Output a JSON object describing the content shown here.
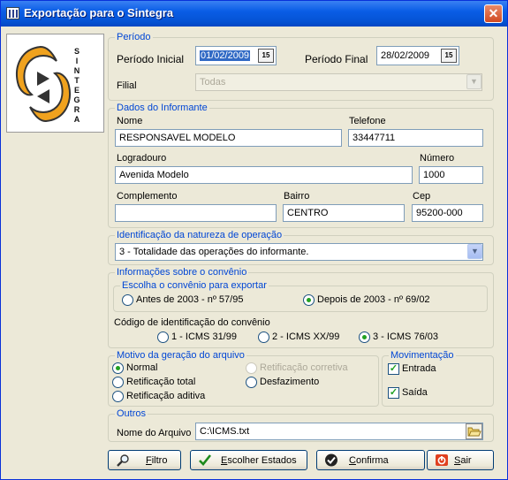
{
  "window": {
    "title": "Exportação para o Sintegra",
    "close_glyph": "✕"
  },
  "logo": {
    "letters": [
      "S",
      "I",
      "N",
      "T",
      "E",
      "G",
      "R",
      "A"
    ]
  },
  "periodo": {
    "legend": "Período",
    "inicial_label": "Período Inicial",
    "inicial_value": "01/02/2009",
    "final_label": "Período Final",
    "final_value": "28/02/2009",
    "calendar_icon": "calendar-icon",
    "calendar_glyph": "15",
    "filial_label": "Filial",
    "filial_value": "Todas"
  },
  "informante": {
    "legend": "Dados do Informante",
    "nome_label": "Nome",
    "nome_value": "RESPONSAVEL MODELO",
    "telefone_label": "Telefone",
    "telefone_value": "33447711",
    "logradouro_label": "Logradouro",
    "logradouro_value": "Avenida Modelo",
    "numero_label": "Número",
    "numero_value": "1000",
    "complemento_label": "Complemento",
    "complemento_value": "",
    "bairro_label": "Bairro",
    "bairro_value": "CENTRO",
    "cep_label": "Cep",
    "cep_value": "95200-000"
  },
  "natureza": {
    "legend": "Identificação da natureza de operação",
    "value": "3 - Totalidade das operações do informante."
  },
  "convenio": {
    "legend": "Informações sobre o convênio",
    "escolha_legend": "Escolha o convênio para exportar",
    "opt_antes": "Antes de 2003 - nº 57/95",
    "opt_depois": "Depois de 2003 - nº 69/02",
    "codigo_label": "Código de identificação do convênio",
    "cod_1": "1 - ICMS 31/99",
    "cod_2": "2 - ICMS XX/99",
    "cod_3": "3 - ICMS 76/03"
  },
  "motivo": {
    "legend": "Motivo da geração do arquivo",
    "normal": "Normal",
    "ret_corretiva": "Retificação corretiva",
    "ret_total": "Retificação total",
    "desfazimento": "Desfazimento",
    "ret_aditiva": "Retificação aditiva"
  },
  "movimentacao": {
    "legend": "Movimentação",
    "entrada": "Entrada",
    "saida": "Saída",
    "check_glyph": "✓"
  },
  "outros": {
    "legend": "Outros",
    "arquivo_label": "Nome do Arquivo",
    "arquivo_value": "C:\\ICMS.txt",
    "folder_icon": "folder-open-icon"
  },
  "buttons": {
    "filtro_hot": "F",
    "filtro_rest": "iltro",
    "estados_hot": "E",
    "estados_rest": "scolher Estados",
    "confirma_hot": "C",
    "confirma_rest": "onfirma",
    "sair_hot": "S",
    "sair_rest": "air"
  },
  "colors": {
    "accent": "#0046d5",
    "titlebar": "#0553d4",
    "logo_orange": "#f0a21e"
  }
}
